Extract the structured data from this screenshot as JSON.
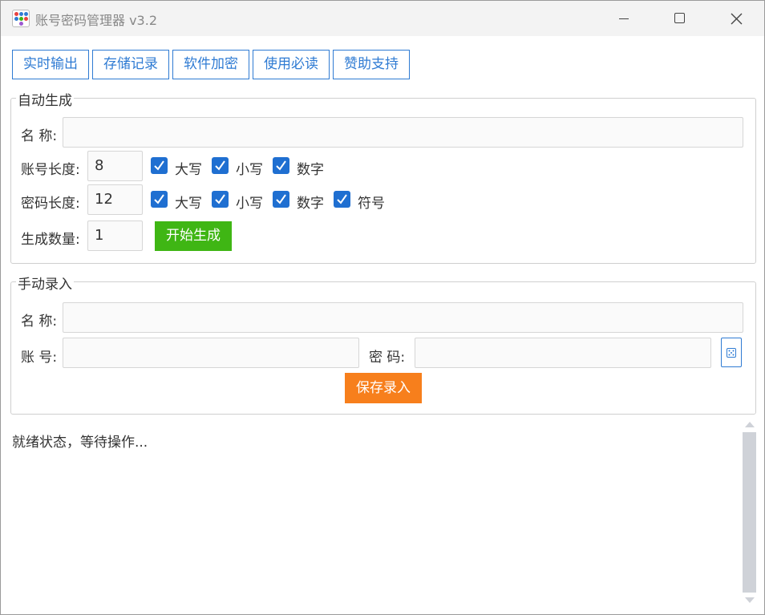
{
  "window": {
    "title": "账号密码管理器 v3.2"
  },
  "toolbar": {
    "buttons": [
      "实时输出",
      "存储记录",
      "软件加密",
      "使用必读",
      "赞助支持"
    ]
  },
  "auto_generate": {
    "legend": "自动生成",
    "name_label": "名 称:",
    "name_value": "",
    "account_length_label": "账号长度:",
    "account_length_value": "8",
    "account_options": [
      "大写",
      "小写",
      "数字"
    ],
    "password_length_label": "密码长度:",
    "password_length_value": "12",
    "password_options": [
      "大写",
      "小写",
      "数字",
      "符号"
    ],
    "count_label": "生成数量:",
    "count_value": "1",
    "generate_button": "开始生成"
  },
  "manual_entry": {
    "legend": "手动录入",
    "name_label": "名 称:",
    "name_value": "",
    "account_label": "账 号:",
    "account_value": "",
    "password_label": "密 码:",
    "password_value": "",
    "save_button": "保存录入"
  },
  "log": {
    "status_text": "就绪状态，等待操作..."
  },
  "colors": {
    "accent_blue": "#2f7bd3",
    "checkbox_blue": "#1f6fd1",
    "generate_green": "#3fb614",
    "save_orange": "#f77f1c"
  }
}
